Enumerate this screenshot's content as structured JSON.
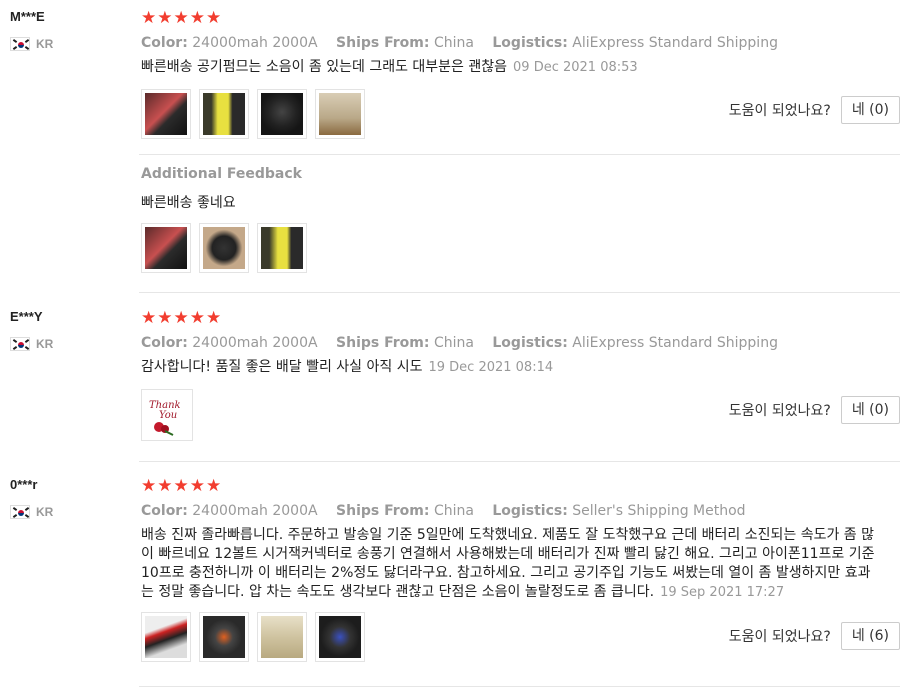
{
  "helpful_label": "도움이 되었나요?",
  "reviews": [
    {
      "user": "M***E",
      "country": "KR",
      "stars": "★★★★★",
      "color_label": "Color:",
      "color_value": "24000mah 2000A",
      "ships_label": "Ships From:",
      "ships_value": "China",
      "logistics_label": "Logistics:",
      "logistics_value": "AliExpress Standard Shipping",
      "text": "빠른배송 공기펌므는 소음이 좀 있는데 그래도 대부분은 괜찮음",
      "date": "09 Dec 2021 08:53",
      "helpful_count": "네 (0)",
      "additional_title": "Additional Feedback",
      "additional_text": "빠른배송 좋네요"
    },
    {
      "user": "E***Y",
      "country": "KR",
      "stars": "★★★★★",
      "color_label": "Color:",
      "color_value": "24000mah 2000A",
      "ships_label": "Ships From:",
      "ships_value": "China",
      "logistics_label": "Logistics:",
      "logistics_value": "AliExpress Standard Shipping",
      "text": "감사합니다! 품질 좋은 배달 빨리 사실 아직 시도",
      "date": "19 Dec 2021 08:14",
      "helpful_count": "네 (0)",
      "thank_you_img_text": "Thank You"
    },
    {
      "user": "0***r",
      "country": "KR",
      "stars": "★★★★★",
      "color_label": "Color:",
      "color_value": "24000mah 2000A",
      "ships_label": "Ships From:",
      "ships_value": "China",
      "logistics_label": "Logistics:",
      "logistics_value": "Seller's Shipping Method",
      "text_lines": [
        "배송 진짜 졸라빠릅니다. 주문하고 발송일 기준 5일만에 도착했네요. 제품도 잘 도착했구요 근데 배터리 소진되는 속도가 좀 많",
        "이 빠르네요 12볼트 시거잭커넥터로 송풍기 연결해서 사용해봤는데 배터리가 진짜 빨리 닳긴 해요. 그리고 아이폰11프로 기준",
        "10프로 충전하니까 이 배터리는 2%정도 닳더라구요. 참고하세요. 그리고 공기주입 기능도 써봤는데 열이 좀 발생하지만 효과",
        "는 정말 좋습니다. 압 차는 속도도 생각보다 괜찮고 단점은 소음이 놀랄정도로 좀 큽니다."
      ],
      "date": "19 Sep 2021 17:27",
      "helpful_count": "네 (6)"
    }
  ]
}
